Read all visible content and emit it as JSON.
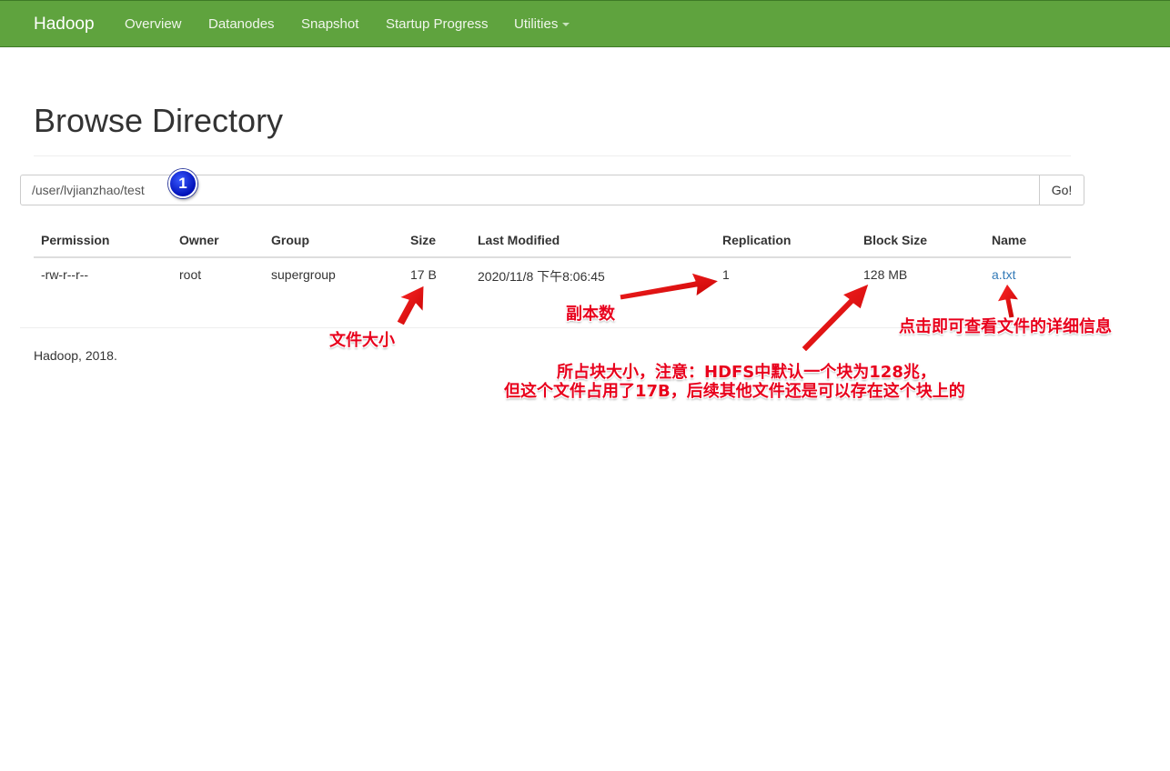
{
  "navbar": {
    "brand": "Hadoop",
    "items": [
      {
        "label": "Overview"
      },
      {
        "label": "Datanodes"
      },
      {
        "label": "Snapshot"
      },
      {
        "label": "Startup Progress"
      },
      {
        "label": "Utilities"
      }
    ]
  },
  "page": {
    "title": "Browse Directory",
    "path_value": "/user/lvjianzhao/test",
    "go_label": "Go!"
  },
  "badge": "1",
  "table": {
    "headers": [
      "Permission",
      "Owner",
      "Group",
      "Size",
      "Last Modified",
      "Replication",
      "Block Size",
      "Name"
    ],
    "rows": [
      {
        "permission": "-rw-r--r--",
        "owner": "root",
        "group": "supergroup",
        "size": "17 B",
        "last_modified": "2020/11/8 下午8:06:45",
        "replication": "1",
        "block_size": "128 MB",
        "name": "a.txt"
      }
    ]
  },
  "footer": "Hadoop, 2018.",
  "annotations": {
    "size_note": "文件大小",
    "replication_note": "副本数",
    "name_note": "点击即可查看文件的详细信息",
    "block_note_line1": "所占块大小，注意：HDFS中默认一个块为128兆，",
    "block_note_line2": "但这个文件占用了17B，后续其他文件还是可以存在这个块上的"
  },
  "colors": {
    "navbar": "#5fa33e",
    "link": "#337ab7",
    "annotation": "#e8001c",
    "badge": "#0010b8"
  }
}
